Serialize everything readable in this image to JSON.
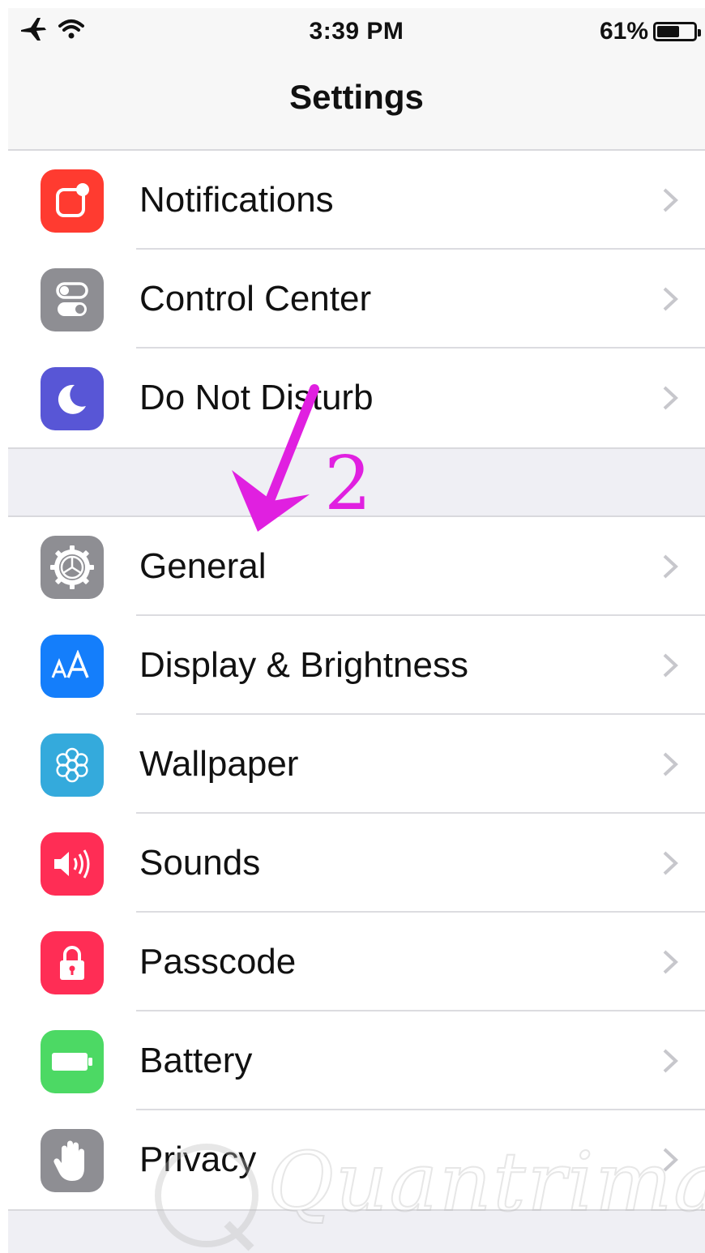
{
  "status": {
    "time": "3:39 PM",
    "battery_percent": "61%",
    "battery_level": 0.61
  },
  "nav": {
    "title": "Settings"
  },
  "groups": [
    {
      "items": [
        {
          "label": "Notifications",
          "icon": "notifications-icon",
          "color": "#ff3b30"
        },
        {
          "label": "Control Center",
          "icon": "control-center-icon",
          "color": "#8e8e93"
        },
        {
          "label": "Do Not Disturb",
          "icon": "moon-icon",
          "color": "#5856d6"
        }
      ]
    },
    {
      "items": [
        {
          "label": "General",
          "icon": "gear-icon",
          "color": "#8e8e93"
        },
        {
          "label": "Display & Brightness",
          "icon": "display-brightness-icon",
          "color": "#147efb"
        },
        {
          "label": "Wallpaper",
          "icon": "wallpaper-icon",
          "color": "#34aadc"
        },
        {
          "label": "Sounds",
          "icon": "speaker-icon",
          "color": "#ff2d55"
        },
        {
          "label": "Passcode",
          "icon": "lock-icon",
          "color": "#ff2d55"
        },
        {
          "label": "Battery",
          "icon": "battery-icon",
          "color": "#4cd964"
        },
        {
          "label": "Privacy",
          "icon": "hand-icon",
          "color": "#8e8e93"
        }
      ]
    }
  ],
  "annotation": {
    "step": "2",
    "color": "#e020e0"
  },
  "watermark": {
    "text": "Quantrimang"
  }
}
